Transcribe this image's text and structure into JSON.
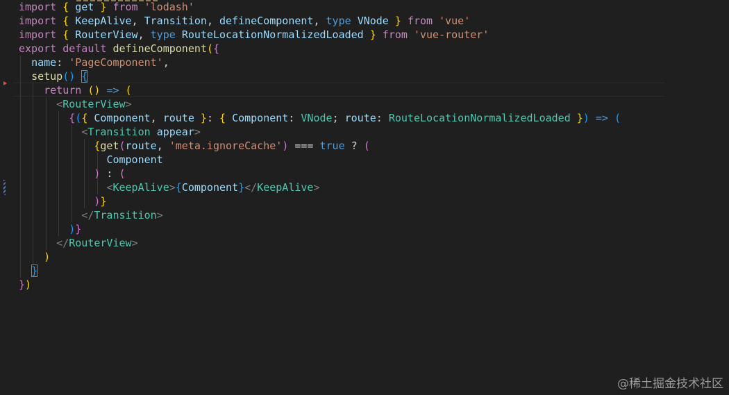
{
  "editor": {
    "tokens": {
      "import": "import",
      "from": "from",
      "type": "type",
      "export": "export",
      "default": "default",
      "return": "return",
      "true": "true",
      "get": "get",
      "KeepAlive": "KeepAlive",
      "Transition": "Transition",
      "defineComponent": "defineComponent",
      "VNode": "VNode",
      "RouterView": "RouterView",
      "RouteLocationNormalizedLoaded": "RouteLocationNormalizedLoaded",
      "lodash": "'lodash'",
      "vue": "'vue'",
      "vue_router": "'vue-router'",
      "name": "name",
      "PageComponent": "'PageComponent'",
      "setup": "setup",
      "Component": "Component",
      "route": "route",
      "appear": "appear",
      "meta_ignoreCache": "'meta.ignoreCache'",
      "strict_eq": "===",
      "arrow": "=>"
    }
  },
  "watermark": "@稀土掘金技术社区"
}
